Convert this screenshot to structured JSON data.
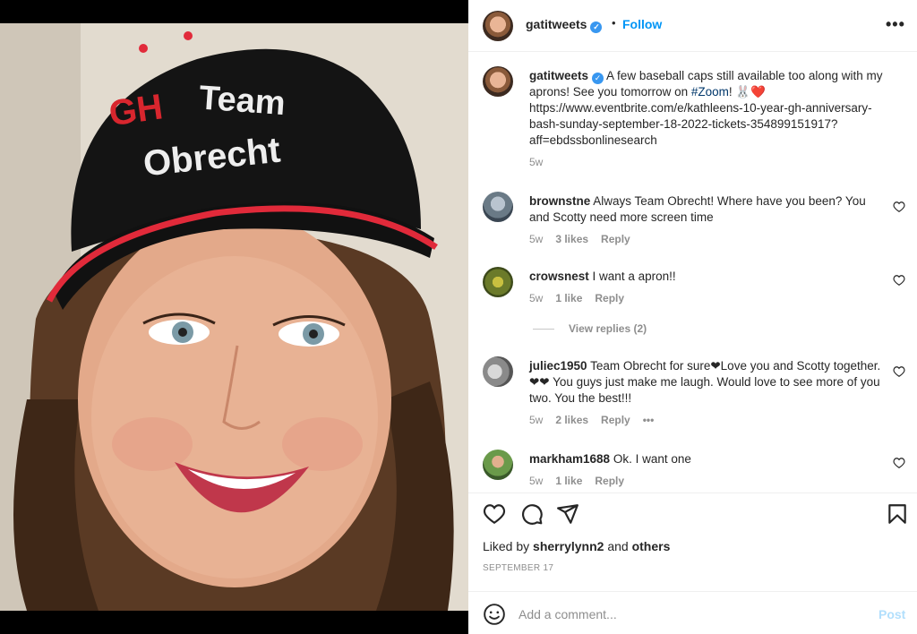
{
  "post": {
    "username": "gatitweets",
    "follow_label": "Follow",
    "separator": "•",
    "more_label": "•••",
    "verified_glyph": "✓",
    "cap_text_left": "GH",
    "cap_text_right_1": "Team",
    "cap_text_right_2": "Obrecht"
  },
  "caption": {
    "username": "gatitweets",
    "text_before_link": "A few baseball caps still available too along with my aprons! See you tomorrow on",
    "hashtag": "#Zoom",
    "text_after_hashtag": "! 🐰❤️ https://www.eventbrite.com/e/kathleens-10-year-gh-anniversary-bash-sunday-september-18-2022-tickets-354899151917?aff=ebdssbonlinesearch",
    "time": "5w"
  },
  "comments": [
    {
      "username": "brownstne",
      "text": "Always Team Obrecht! Where have you been? You and Scotty need more screen time",
      "time": "5w",
      "likes": "3 likes",
      "reply": "Reply"
    },
    {
      "username": "crowsnest",
      "text": "I want a apron!!",
      "time": "5w",
      "likes": "1 like",
      "reply": "Reply"
    },
    {
      "username": "juliec1950",
      "text": "Team Obrecht for sure❤Love you and Scotty together.❤❤ You guys just make me laugh. Would love to see more of you two. You the best!!!",
      "time": "5w",
      "likes": "2 likes",
      "reply": "Reply",
      "more": "•••"
    },
    {
      "username": "markham1688",
      "text": "Ok. I want one",
      "time": "5w",
      "likes": "1 like",
      "reply": "Reply"
    }
  ],
  "view_replies": "View replies (2)",
  "likes_line": {
    "prefix": "Liked by",
    "user": "sherrylynn2",
    "and": "and",
    "others": "others"
  },
  "date": "SEPTEMBER 17",
  "add_comment": {
    "placeholder": "Add a comment...",
    "post_label": "Post"
  },
  "colors": {
    "accent": "#0095f6",
    "verified": "#3897f0",
    "muted": "#8e8e8e"
  }
}
